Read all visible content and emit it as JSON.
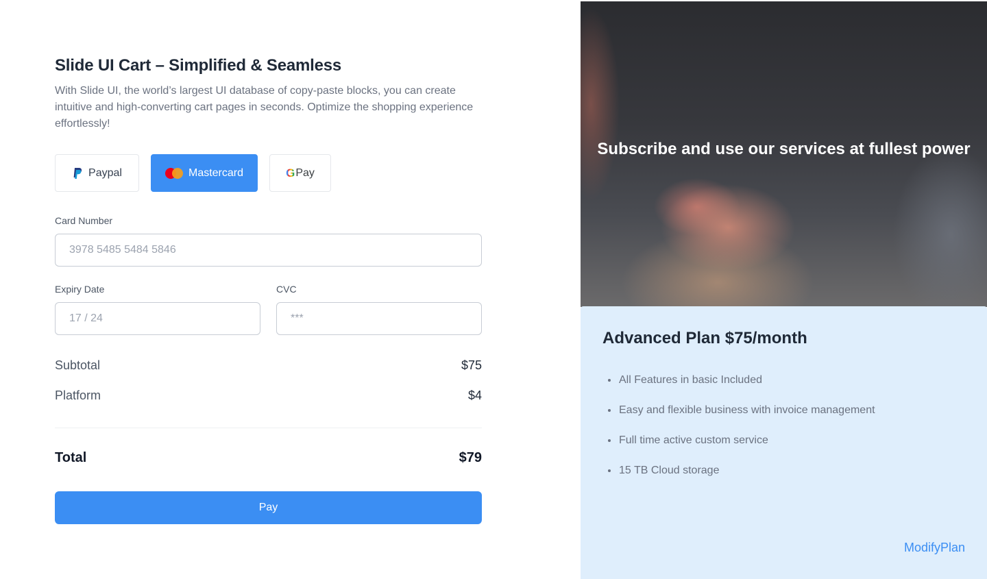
{
  "checkout": {
    "title": "Slide UI Cart – Simplified & Seamless",
    "description": "With Slide UI, the world’s largest UI database of copy-paste blocks, you can create intuitive and high-converting cart pages in seconds. Optimize the shopping experience effortlessly!",
    "payment_methods": [
      {
        "label": "Paypal",
        "icon": "paypal-icon",
        "selected": false
      },
      {
        "label": "Mastercard",
        "icon": "mastercard-icon",
        "selected": true
      },
      {
        "label": "Pay",
        "icon": "google-pay-icon",
        "selected": false
      }
    ],
    "card_number": {
      "label": "Card Number",
      "placeholder": "3978 5485 5484 5846"
    },
    "expiry": {
      "label": "Expiry Date",
      "placeholder": "17 / 24"
    },
    "cvc": {
      "label": "CVC",
      "placeholder": "***"
    },
    "summary": {
      "subtotal_label": "Subtotal",
      "subtotal_value": "$75",
      "platform_label": "Platform",
      "platform_value": "$4",
      "total_label": "Total",
      "total_value": "$79"
    },
    "pay_label": "Pay"
  },
  "promo": {
    "headline": "Subscribe and use our services at fullest power"
  },
  "plan": {
    "title": "Advanced Plan $75/month",
    "features": [
      "All Features in basic Included",
      "Easy and flexible business with invoice management",
      "Full time active custom service",
      "15 TB Cloud storage"
    ],
    "modify_label": "ModifyPlan"
  },
  "colors": {
    "accent": "#3b8ef3",
    "plan_bg": "#dfeefc"
  }
}
